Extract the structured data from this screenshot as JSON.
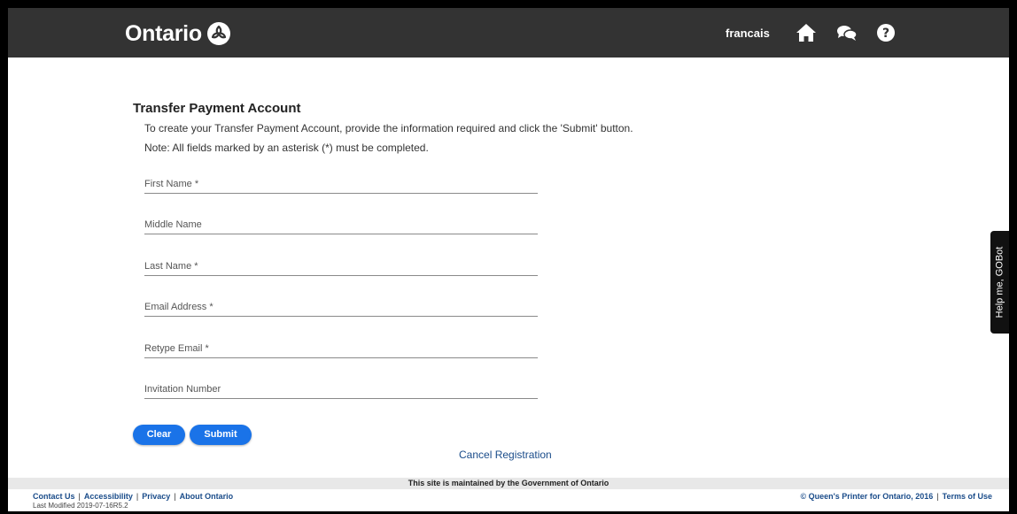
{
  "header": {
    "brand": "Ontario",
    "language_link": "francais",
    "icons": [
      "home-icon",
      "chat-icon",
      "help-icon"
    ],
    "bg_color": "#333333"
  },
  "form": {
    "title": "Transfer Payment Account",
    "intro": "To create your Transfer Payment Account, provide the information required and click the 'Submit' button.",
    "note": "Note: All fields marked by an asterisk (*) must be completed.",
    "fields": [
      {
        "label": "First Name *",
        "value": ""
      },
      {
        "label": "Middle Name",
        "value": ""
      },
      {
        "label": "Last Name *",
        "value": ""
      },
      {
        "label": "Email Address *",
        "value": ""
      },
      {
        "label": "Retype Email *",
        "value": ""
      },
      {
        "label": "Invitation Number",
        "value": ""
      }
    ],
    "buttons": {
      "clear": "Clear",
      "submit": "Submit"
    },
    "cancel_link": "Cancel Registration",
    "accent_color": "#1a73e8"
  },
  "gobot": {
    "label": "Help me, GOBot"
  },
  "footer": {
    "maintained": "This site is maintained by the Government of Ontario",
    "links": [
      "Contact Us",
      "Accessibility",
      "Privacy",
      "About Ontario"
    ],
    "last_modified": "Last Modified  2019-07-16R5.2",
    "copyright": "© Queen's Printer for Ontario, 2016",
    "terms": "Terms of Use"
  }
}
